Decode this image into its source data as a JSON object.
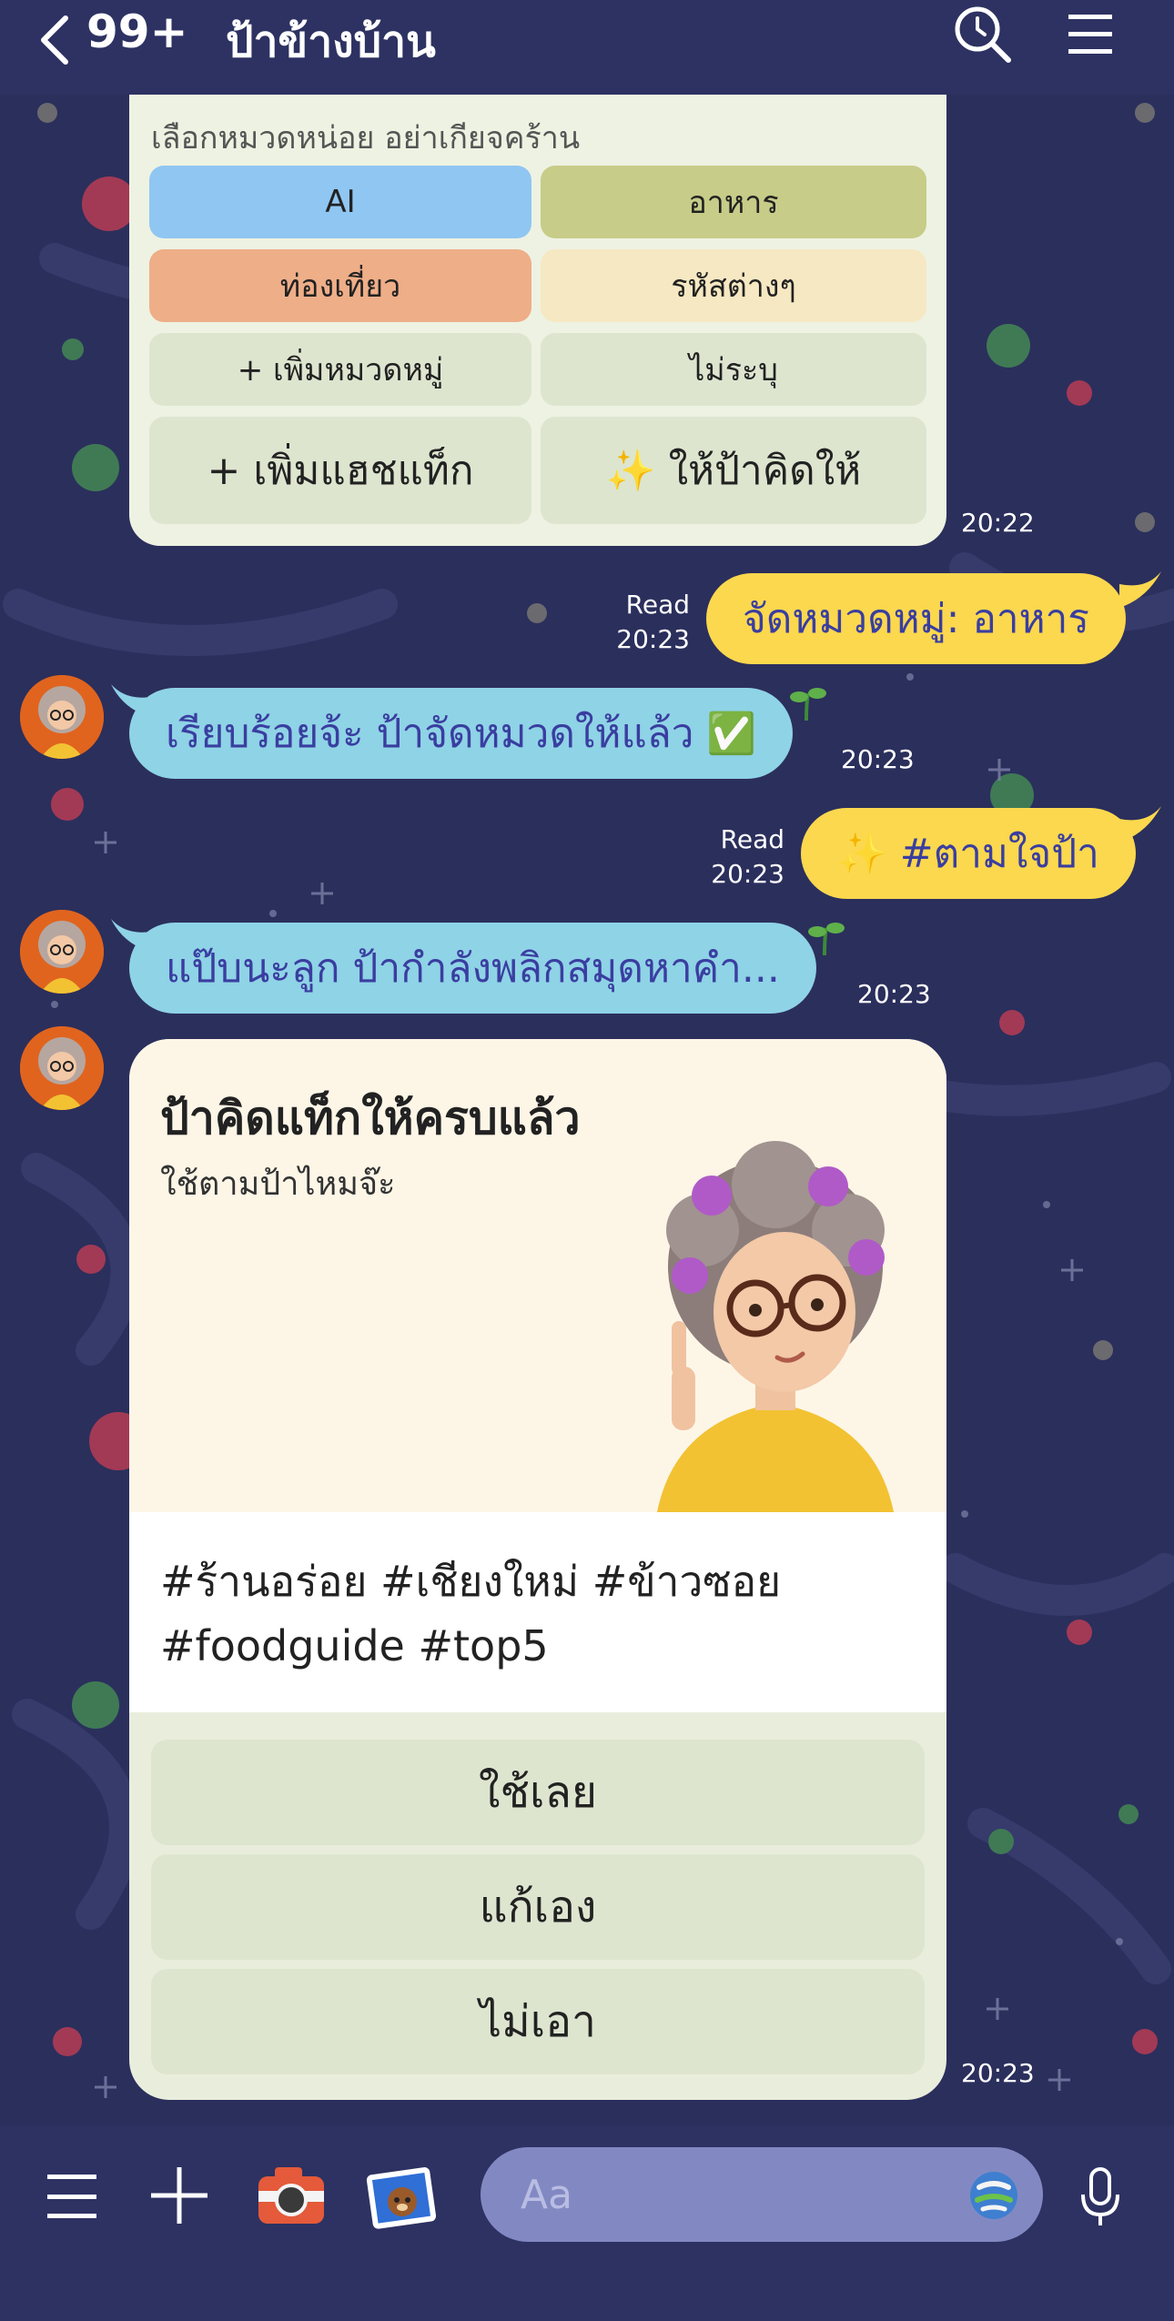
{
  "header": {
    "unread_count": "99+",
    "chat_title": "ป้าข้างบ้าน"
  },
  "card1": {
    "prompt": "เลือกหมวดหน่อย อย่าเกียจคร้าน",
    "buttons": [
      "AI",
      "อาหาร",
      "ท่องเที่ยว",
      "รหัสต่างๆ",
      "+ เพิ่มหมวดหมู่",
      "ไม่ระบุ",
      "+ เพิ่มแฮชแท็ก",
      "✨ ให้ป้าคิดให้"
    ],
    "time": "20:22"
  },
  "messages": [
    {
      "text": "จัดหมวดหมู่: อาหาร",
      "read": "Read",
      "time": "20:23"
    },
    {
      "text": "เรียบร้อยจ้ะ ป้าจัดหมวดให้แล้ว ✅",
      "time": "20:23"
    },
    {
      "text": "✨ #ตามใจป้า",
      "read": "Read",
      "time": "20:23"
    },
    {
      "text": "แป๊บนะลูก ป้ากำลังพลิกสมุดหาคำ...",
      "time": "20:23"
    }
  ],
  "card2": {
    "title": "ป้าคิดแท็กให้ครบแล้ว",
    "subtitle": "ใช้ตามป้าไหมจ๊ะ",
    "tags_line1": "#ร้านอร่อย #เชียงใหม่ #ข้าวซอย",
    "tags_line2": "#foodguide #top5",
    "actions": [
      "ใช้เลย",
      "แก้เอง",
      "ไม่เอา"
    ],
    "time": "20:23"
  },
  "composer": {
    "placeholder": "Aa"
  },
  "colors": {
    "background": "#2b2f5c",
    "bubble_blue": "#8fd3e6",
    "bubble_yellow": "#fbd84e",
    "bubble_text": "#3a3ea0"
  }
}
